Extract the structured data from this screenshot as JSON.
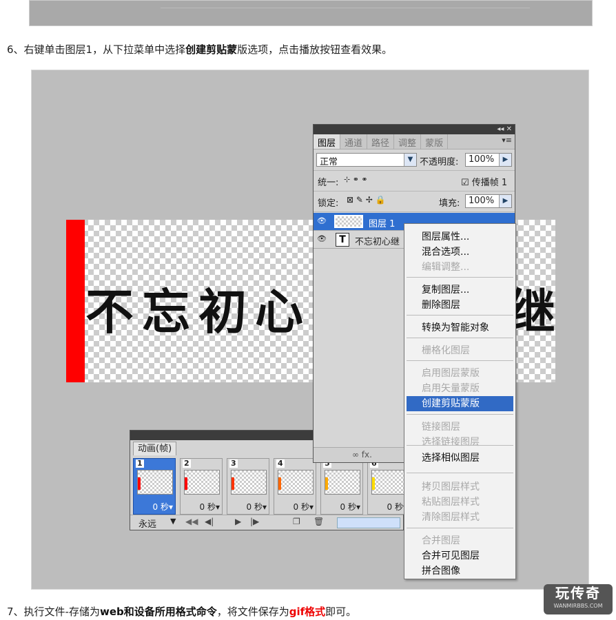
{
  "step6": {
    "prefix": "6、右键单击图层1，从下拉菜单中选择",
    "bold": "创建剪贴蒙",
    "suffix": "版选项，点击播放按钮查看效果。"
  },
  "step7": {
    "prefix": "7、执行文件-存储为",
    "bold": "web和设备所用格式命令",
    "mid": "，将文件保存为",
    "red": "gif格式",
    "suffix": "即可。"
  },
  "canvas": {
    "text_left": "不忘初心",
    "text_right": "继",
    "red_color": "#ff0000"
  },
  "layers_panel": {
    "tabs": [
      "图层",
      "通道",
      "路径",
      "调整",
      "蒙版"
    ],
    "blend_mode": "正常",
    "opacity_label": "不透明度:",
    "opacity_value": "100%",
    "unify_label": "统一:",
    "propagate_label": "传播帧 1",
    "lock_label": "锁定:",
    "fill_label": "填充:",
    "fill_value": "100%",
    "layers": [
      {
        "name": "图层 1",
        "selected": true
      },
      {
        "name": "不忘初心继",
        "selected": false
      }
    ],
    "bottom_icons": "∞ fx."
  },
  "context_menu": {
    "items": [
      {
        "label": "图层属性...",
        "disabled": false
      },
      {
        "label": "混合选项...",
        "disabled": false
      },
      {
        "label": "编辑调整...",
        "disabled": true
      },
      {
        "label": "复制图层...",
        "disabled": false
      },
      {
        "label": "删除图层",
        "disabled": false
      },
      {
        "label": "转换为智能对象",
        "disabled": false
      },
      {
        "label": "栅格化图层",
        "disabled": true
      },
      {
        "label": "启用图层蒙版",
        "disabled": true
      },
      {
        "label": "启用矢量蒙版",
        "disabled": true
      },
      {
        "label": "创建剪贴蒙版",
        "disabled": false,
        "highlighted": true
      },
      {
        "label": "链接图层",
        "disabled": true
      },
      {
        "label": "选择链接图层",
        "disabled": true
      },
      {
        "label": "选择相似图层",
        "disabled": false
      },
      {
        "label": "拷贝图层样式",
        "disabled": true
      },
      {
        "label": "粘贴图层样式",
        "disabled": true
      },
      {
        "label": "清除图层样式",
        "disabled": true
      },
      {
        "label": "合并图层",
        "disabled": true
      },
      {
        "label": "合并可见图层",
        "disabled": false
      },
      {
        "label": "拼合图像",
        "disabled": false
      }
    ]
  },
  "animation_panel": {
    "tab": "动画(帧)",
    "frames": [
      {
        "num": "1",
        "delay": "0 秒▾",
        "color": "#ff0000"
      },
      {
        "num": "2",
        "delay": "0 秒▾",
        "color": "#ff0000"
      },
      {
        "num": "3",
        "delay": "0 秒▾",
        "color": "#ff3300"
      },
      {
        "num": "4",
        "delay": "0 秒▾",
        "color": "#ff6600"
      },
      {
        "num": "5",
        "delay": "0 秒▾",
        "color": "#ffaa00"
      },
      {
        "num": "6",
        "delay": "0 秒▾",
        "color": "#ffdd00"
      }
    ],
    "loop": "永远"
  },
  "watermark": {
    "title": "玩传奇",
    "url": "WANMIRBBS.COM"
  }
}
